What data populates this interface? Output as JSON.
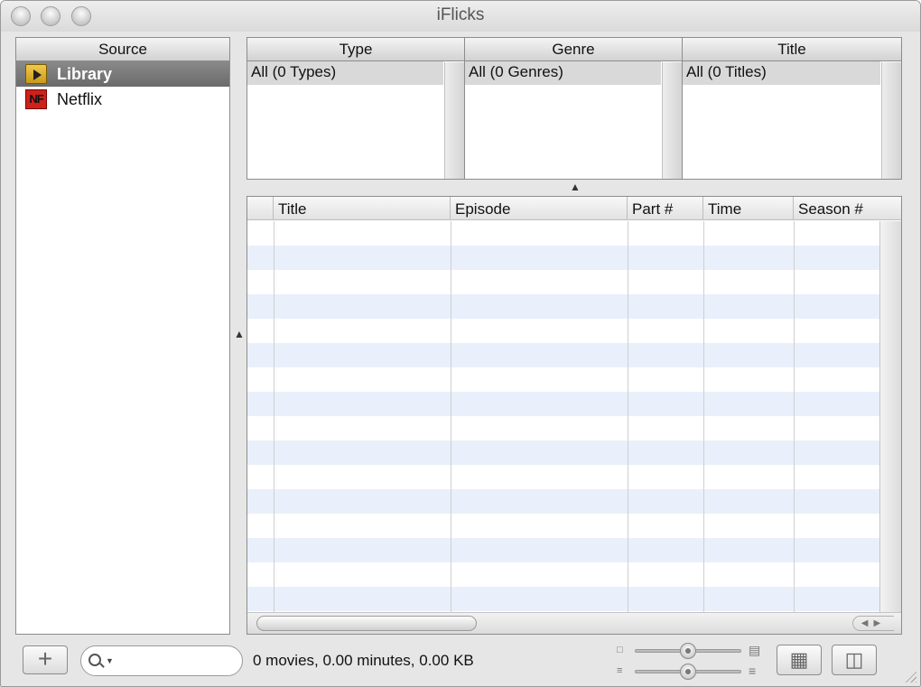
{
  "window": {
    "title": "iFlicks"
  },
  "source": {
    "header": "Source",
    "items": [
      {
        "label": "Library",
        "icon": "library-icon",
        "selected": true
      },
      {
        "label": "Netflix",
        "icon": "netflix-icon",
        "icon_text": "NF",
        "selected": false
      }
    ]
  },
  "browser": {
    "columns": [
      {
        "header": "Type",
        "row": "All (0 Types)"
      },
      {
        "header": "Genre",
        "row": "All (0 Genres)"
      },
      {
        "header": "Title",
        "row": "All (0 Titles)"
      }
    ]
  },
  "table": {
    "columns": [
      "Title",
      "Episode",
      "Part #",
      "Time",
      "Season #"
    ],
    "stripe_color": "#e9f0fb"
  },
  "status": {
    "text": "0 movies, 0.00 minutes, 0.00 KB"
  },
  "toolbar": {
    "add_label": "+"
  }
}
